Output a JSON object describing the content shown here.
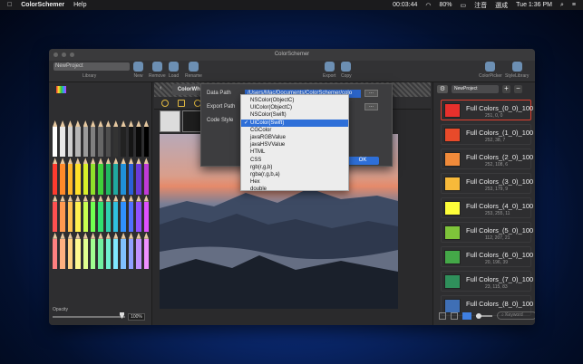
{
  "menubar": {
    "app": "ColorSchemer",
    "help": "Help",
    "time_rec": "00:03:44",
    "battery": "80%",
    "input": "注音",
    "ime": "選成",
    "clock": "Tue 1:36 PM"
  },
  "window": {
    "title": "ColorSchemer"
  },
  "toolbar": {
    "project_value": "NewProject",
    "library": "Library",
    "new": "New",
    "remove": "Remove",
    "load": "Load",
    "rename": "Rename",
    "export": "Export",
    "copy": "Copy",
    "colorpicker": "ColorPicker",
    "stylelibrary": "StyleLibrary"
  },
  "left": {
    "opacity_label": "Opacity",
    "opacity_value": "100%"
  },
  "center": {
    "tab": "ColorWhe"
  },
  "right": {
    "project_select": "NewProject",
    "plus": "+",
    "minus": "−",
    "keyword_placeholder": "Keyword",
    "items": [
      {
        "name": "Full Colors_(0_0)_100",
        "rgb": "251, 0, 0",
        "color": "#e8302c"
      },
      {
        "name": "Full Colors_(1_0)_100",
        "rgb": "252, 38, 7",
        "color": "#e84a2a"
      },
      {
        "name": "Full Colors_(2_0)_100",
        "rgb": "252, 108, 6",
        "color": "#f08a3a"
      },
      {
        "name": "Full Colors_(3_0)_100",
        "rgb": "253, 179, 9",
        "color": "#f7b93a"
      },
      {
        "name": "Full Colors_(4_0)_100",
        "rgb": "253, 255, 11",
        "color": "#ffff3a"
      },
      {
        "name": "Full Colors_(5_0)_100",
        "rgb": "112, 207, 21",
        "color": "#7ec43a"
      },
      {
        "name": "Full Colors_(6_0)_100",
        "rgb": "20, 196, 39",
        "color": "#44a848"
      },
      {
        "name": "Full Colors_(7_0)_100",
        "rgb": "23, 115, 83",
        "color": "#2f8f5b"
      },
      {
        "name": "Full Colors_(8_0)_100",
        "rgb": "",
        "color": "#3f6fb5"
      }
    ]
  },
  "sheet": {
    "data_path_label": "Data Path",
    "data_path_value": "/Users/Mac/Documents/ColorSchemer/colo",
    "export_path_label": "Export Path",
    "code_style_label": "Code Style",
    "browse": "...",
    "ok": "OK"
  },
  "dropdown": {
    "options": [
      "NSColor(ObjectC)",
      "UIColor(ObjectC)",
      "NSColor(Swift)",
      "UIColor(Swift)",
      "CGColor",
      "javaRGBValue",
      "javaHSVValue",
      "HTML",
      "CSS",
      "rgb(r,g,b)",
      "rgba(r,g,b,a)",
      "Hex",
      "double"
    ],
    "selected_index": 3
  }
}
